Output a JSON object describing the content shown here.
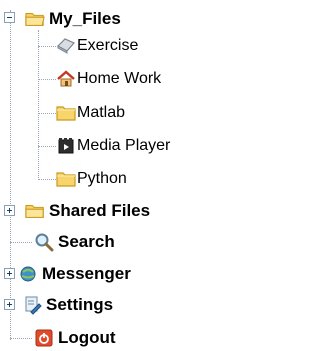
{
  "tree": {
    "root": {
      "label": "My_Files",
      "expanded": true
    },
    "children": [
      {
        "label": "Exercise",
        "icon": "exercise-icon"
      },
      {
        "label": "Home Work",
        "icon": "home-work-icon"
      },
      {
        "label": "Matlab",
        "icon": "folder-icon"
      },
      {
        "label": "Media Player",
        "icon": "media-player-icon"
      },
      {
        "label": "Python",
        "icon": "folder-icon"
      }
    ],
    "items": [
      {
        "label": "Shared Files",
        "icon": "folder-icon",
        "expander": "plus"
      },
      {
        "label": "Search",
        "icon": "search-icon"
      },
      {
        "label": "Messenger",
        "icon": "messenger-icon",
        "expander": "plus"
      },
      {
        "label": "Settings",
        "icon": "settings-icon",
        "expander": "plus"
      },
      {
        "label": "Logout",
        "icon": "logout-icon"
      }
    ]
  },
  "colors": {
    "folder": "#f5c842",
    "folder_edge": "#c99a1d",
    "guide_lines": "#9aa9b8",
    "logout": "#e04a2b"
  }
}
